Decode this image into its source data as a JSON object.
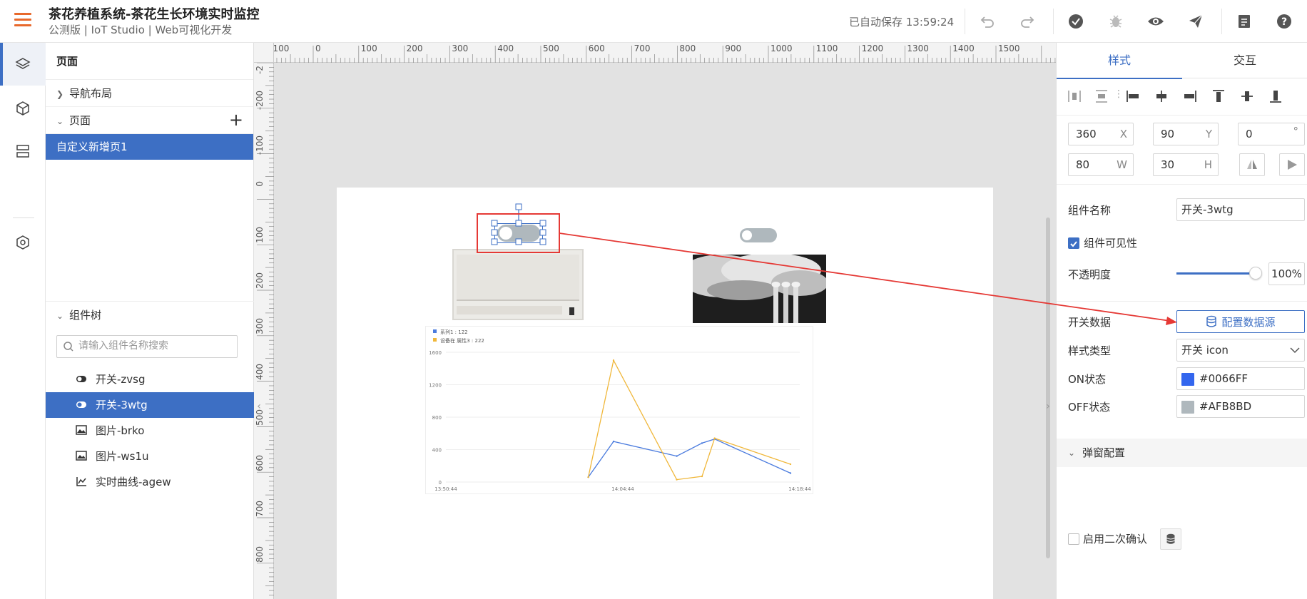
{
  "header": {
    "title": "茶花养植系统-茶花生长环境实时监控",
    "subtitle": "公测版 | IoT Studio | Web可视化开发",
    "autosave": "已自动保存 13:59:24"
  },
  "colors": {
    "accent": "#3d6fc4",
    "brand": "#e8692c",
    "series1": "#4a7bde",
    "series2": "#f0b73a",
    "annotation": "#e53935"
  },
  "left_panel": {
    "title": "页面",
    "nav_layout": "导航布局",
    "pages_label": "页面",
    "selected_page": "自定义新增页1",
    "tree_label": "组件树",
    "search_placeholder": "请输入组件名称搜索",
    "tree_items": [
      {
        "label": "开关-zvsg",
        "icon": "toggle-icon"
      },
      {
        "label": "开关-3wtg",
        "icon": "toggle-icon",
        "selected": true
      },
      {
        "label": "图片-brko",
        "icon": "image-icon"
      },
      {
        "label": "图片-ws1u",
        "icon": "image-icon"
      },
      {
        "label": "实时曲线-agew",
        "icon": "line-chart-icon"
      }
    ]
  },
  "ruler": {
    "top": [
      "-100",
      "0",
      "100",
      "200",
      "300",
      "400",
      "500",
      "600",
      "700",
      "800",
      "900",
      "1000",
      "1100",
      "1200",
      "1300",
      "1400",
      "1500"
    ],
    "left": [
      "-2",
      "-200",
      "-100",
      "0",
      "100",
      "200",
      "300",
      "400",
      "500",
      "600",
      "700",
      "800"
    ]
  },
  "canvas_chart": {
    "legend": [
      "系列1 : 122",
      "设备在 属性3 : 222"
    ],
    "x_ticks": [
      "13:50:44",
      "14:04:44",
      "14:18:44"
    ],
    "y_ticks": [
      "0",
      "400",
      "800",
      "1200",
      "1600"
    ]
  },
  "chart_data": {
    "type": "line",
    "x": [
      "14:02",
      "14:04",
      "14:09",
      "14:11",
      "14:12",
      "14:18"
    ],
    "series": [
      {
        "name": "系列1",
        "values": [
          60,
          500,
          320,
          480,
          530,
          110
        ]
      },
      {
        "name": "设备在 属性3",
        "values": [
          60,
          1500,
          30,
          70,
          540,
          220
        ]
      }
    ],
    "ylim": [
      0,
      1600
    ],
    "xlim": [
      "13:50:44",
      "14:18:44"
    ],
    "y_ticks": [
      0,
      400,
      800,
      1200,
      1600
    ],
    "x_ticks": [
      "13:50:44",
      "14:04:44",
      "14:18:44"
    ]
  },
  "right_panel": {
    "tabs": [
      "样式",
      "交互"
    ],
    "x": "360",
    "x_unit": "X",
    "y": "90",
    "y_unit": "Y",
    "rotate": "0",
    "rotate_unit": "°",
    "w": "80",
    "w_unit": "W",
    "h": "30",
    "h_unit": "H",
    "name_label": "组件名称",
    "name_value": "开关-3wtg",
    "visible_label": "组件可见性",
    "opacity_label": "不透明度",
    "opacity_value": "100%",
    "switch_data_label": "开关数据",
    "datasource_button": "配置数据源",
    "style_type_label": "样式类型",
    "style_type_value": "开关 icon",
    "on_label": "ON状态",
    "on_value": "#0066FF",
    "off_label": "OFF状态",
    "off_value": "#AFB8BD",
    "popup_section": "弹窗配置",
    "confirm_label": "启用二次确认"
  }
}
